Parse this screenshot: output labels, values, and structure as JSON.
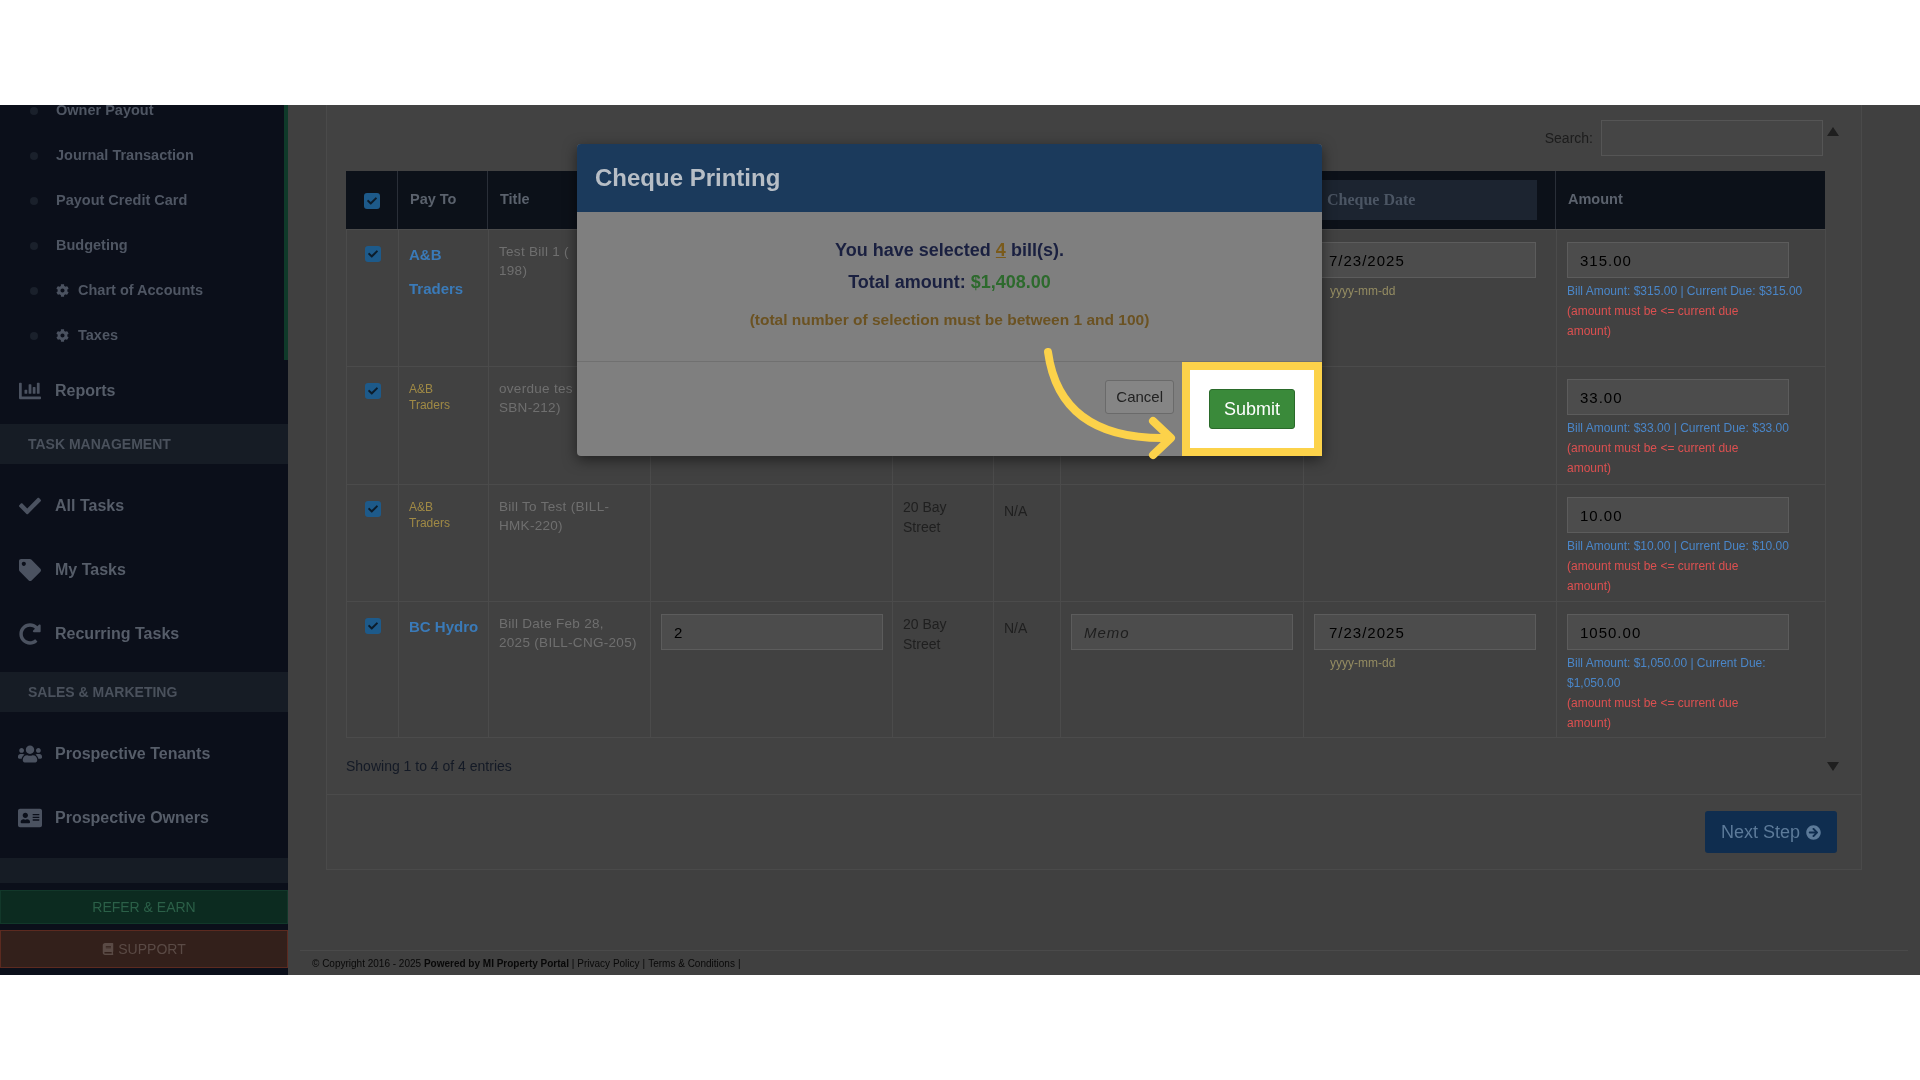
{
  "sidebar": {
    "entries": [
      {
        "kind": "sublink",
        "label": "Owner Payout"
      },
      {
        "kind": "sublink",
        "label": "Journal Transaction"
      },
      {
        "kind": "sublink",
        "label": "Payout Credit Card"
      },
      {
        "kind": "sublink",
        "label": "Budgeting"
      },
      {
        "kind": "settings-sublink",
        "label": "Chart of Accounts"
      },
      {
        "kind": "settings-sublink",
        "label": "Taxes"
      },
      {
        "kind": "link",
        "label": "Reports"
      },
      {
        "kind": "section",
        "label": "TASK MANAGEMENT"
      },
      {
        "kind": "link",
        "label": "All Tasks"
      },
      {
        "kind": "link",
        "label": "My Tasks"
      },
      {
        "kind": "link",
        "label": "Recurring Tasks"
      },
      {
        "kind": "section",
        "label": "SALES & MARKETING"
      },
      {
        "kind": "link",
        "label": "Prospective Tenants"
      },
      {
        "kind": "link",
        "label": "Prospective Owners"
      }
    ],
    "refer_button": "REFER & EARN",
    "support_button": "SUPPORT"
  },
  "search": {
    "label": "Search:"
  },
  "table": {
    "select_all_checked": true,
    "columns": [
      "Pay To",
      "Title",
      "Cheque Date",
      "Amount"
    ],
    "rows": [
      {
        "checked": true,
        "kind": "link",
        "pay_to": "A&B Traders",
        "title_lines": [
          "Test Bill 1 (",
          "198)"
        ],
        "cheque_date": "7/23/2025",
        "date_hint": "yyyy-mm-dd",
        "amount": "315.00",
        "amount_info": "Bill Amount: $315.00 | Current Due: $315.00",
        "amount_warning": "(amount must be <= current due amount)"
      },
      {
        "checked": true,
        "kind": "plain",
        "pay_to": "A&B Traders",
        "title_lines": [
          "overdue tes",
          "SBN-212)"
        ],
        "amount": "33.00",
        "amount_info": "Bill Amount: $33.00 | Current Due: $33.00",
        "amount_warning": "(amount must be <= current due amount)"
      },
      {
        "checked": true,
        "kind": "plain",
        "pay_to": "A&B Traders",
        "title_lines": [
          "Bill To Test (BILL-",
          "HMK-220)"
        ],
        "address": "20 Bay Street",
        "column_6": "N/A",
        "amount": "10.00",
        "amount_info": "Bill Amount: $10.00 | Current Due: $10.00",
        "amount_warning": "(amount must be <= current due amount)"
      },
      {
        "checked": true,
        "kind": "link",
        "pay_to": "BC Hydro",
        "title_lines": [
          "Bill Date Feb 28,",
          "2025 (BILL-CNG-205)"
        ],
        "column_4": "2",
        "address": "20 Bay Street",
        "column_6": "N/A",
        "memo_placeholder": "Memo",
        "cheque_date": "7/23/2025",
        "date_hint": "yyyy-mm-dd",
        "amount": "1050.00",
        "amount_info": "Bill Amount: $1,050.00 | Current Due: $1,050.00",
        "amount_warning": "(amount must be <= current due amount)"
      }
    ],
    "info": "Showing 1 to 4 of 4 entries"
  },
  "next_button": "Next Step",
  "footer": {
    "copyright": "© Copyright 2016 - 2025 **Powered by MI Property Portal** |",
    "links": [
      "Privacy Policy",
      "Terms & Conditions"
    ],
    "separator": "|"
  },
  "modal": {
    "title": "Cheque Printing",
    "selection": {
      "before": "You have selected",
      "count": "4",
      "after": "bill(s)."
    },
    "total": {
      "label": "Total amount:",
      "value": "$1,408.00"
    },
    "note": "(total number of selection must be between 1 and 100)",
    "buttons": [
      {
        "kind": "cancel",
        "label": "Cancel",
        "highlighted": false
      },
      {
        "kind": "submit",
        "label": "Submit",
        "highlighted": true
      }
    ]
  }
}
